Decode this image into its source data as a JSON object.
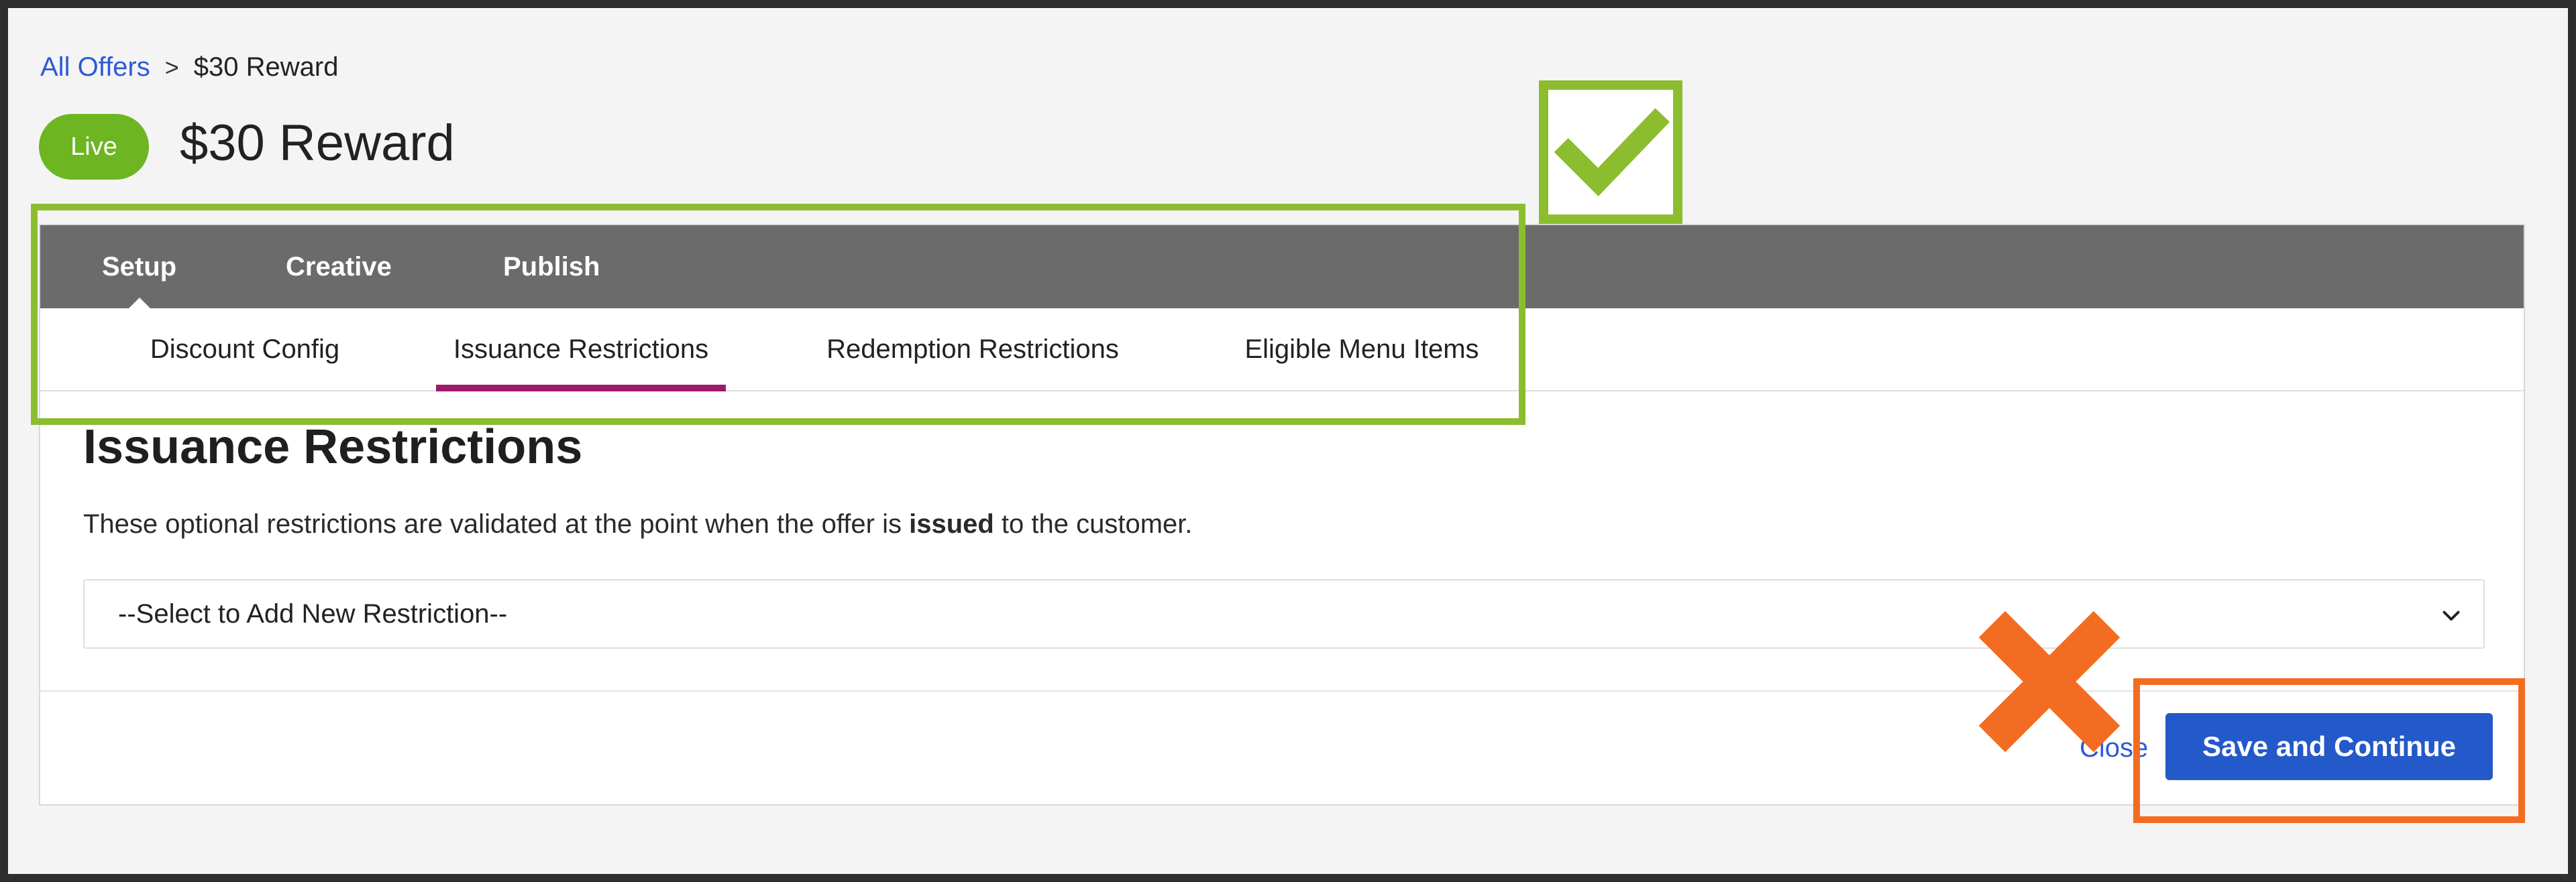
{
  "breadcrumb": {
    "link": "All Offers",
    "separator": ">",
    "current": "$30 Reward"
  },
  "status": {
    "label": "Live",
    "color": "#6db521"
  },
  "page_title": "$30 Reward",
  "top_tabs": [
    {
      "label": "Setup",
      "active": true
    },
    {
      "label": "Creative",
      "active": false
    },
    {
      "label": "Publish",
      "active": false
    }
  ],
  "sub_tabs": [
    {
      "label": "Discount Config",
      "active": false
    },
    {
      "label": "Issuance Restrictions",
      "active": true
    },
    {
      "label": "Redemption Restrictions",
      "active": false
    },
    {
      "label": "Eligible Menu Items",
      "active": false
    }
  ],
  "section": {
    "title": "Issuance Restrictions",
    "desc_before": "These optional restrictions are validated at the point when the offer is ",
    "desc_bold": "issued",
    "desc_after": " to the customer."
  },
  "restriction_select": {
    "selected": "--Select to Add New Restriction--",
    "icon": "chevron-down-icon"
  },
  "footer": {
    "close_label": "Close",
    "primary_label": "Save and Continue"
  },
  "colors": {
    "accent_tab_underline": "#9b1a6a",
    "primary_button": "#2459c9",
    "link": "#2d5bd3",
    "annotation_green": "#8cbd2f",
    "annotation_orange": "#f26d21"
  }
}
